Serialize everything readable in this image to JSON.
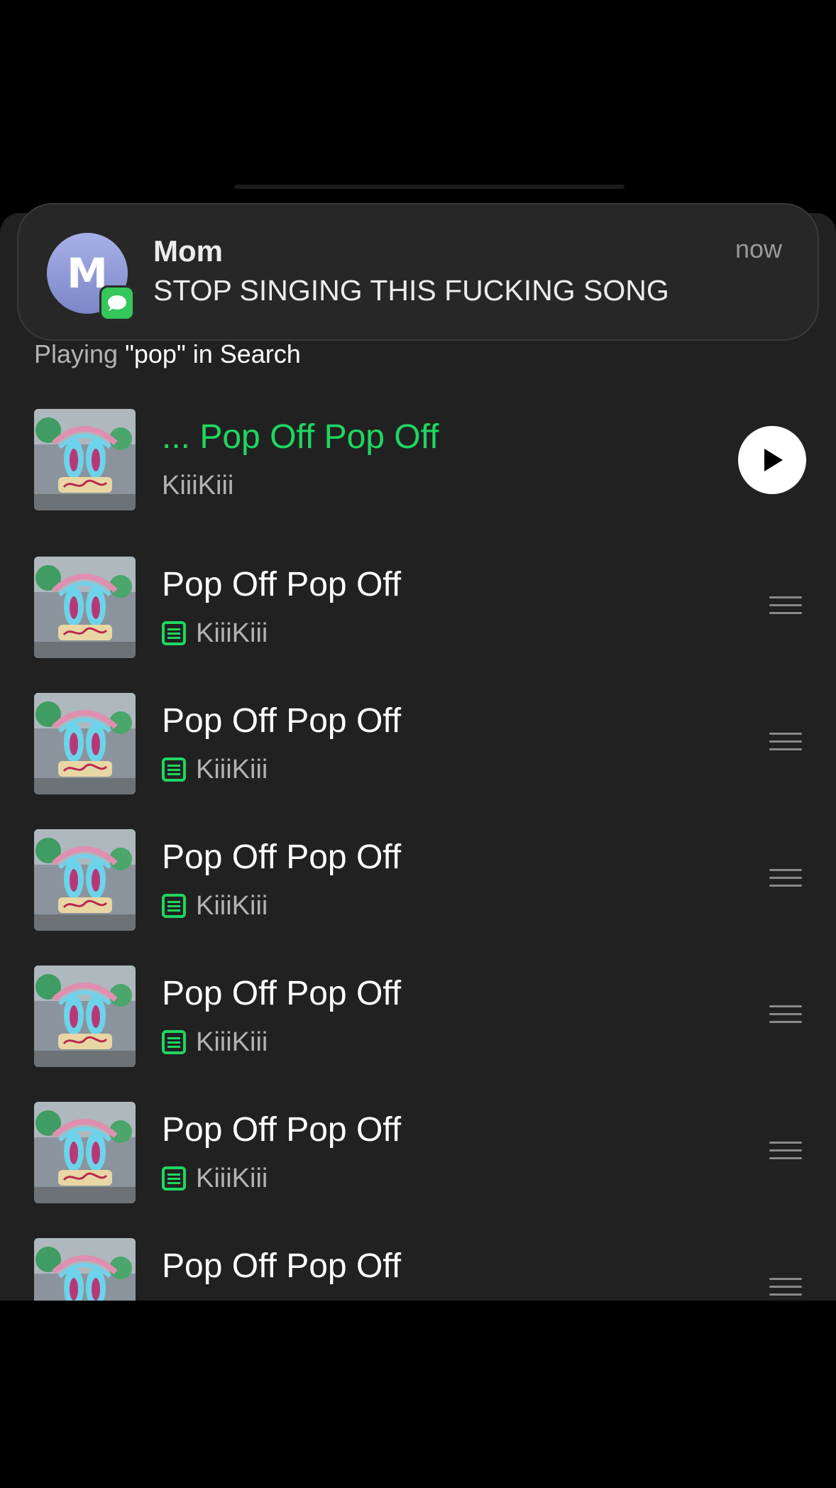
{
  "notification": {
    "avatar_initial": "M",
    "sender": "Mom",
    "message": "STOP SINGING THIS FUCKING SONG",
    "time": "now",
    "app_icon": "messages-icon"
  },
  "queue": {
    "playing_from_prefix": "Playing",
    "playing_from_context": "\"pop\" in Search",
    "current_track": {
      "title": "... Pop Off Pop Off",
      "artist": "KiiiKiii"
    },
    "tracks": [
      {
        "title": "Pop Off Pop Off",
        "artist": "KiiiKiii"
      },
      {
        "title": "Pop Off Pop Off",
        "artist": "KiiiKiii"
      },
      {
        "title": "Pop Off Pop Off",
        "artist": "KiiiKiii"
      },
      {
        "title": "Pop Off Pop Off",
        "artist": "KiiiKiii"
      },
      {
        "title": "Pop Off Pop Off",
        "artist": "KiiiKiii"
      },
      {
        "title": "Pop Off Pop Off",
        "artist": "KiiiKiii"
      }
    ]
  },
  "colors": {
    "accent": "#1ed760",
    "background": "#212121",
    "text_primary": "#ffffff",
    "text_secondary": "#b3b3b3"
  }
}
